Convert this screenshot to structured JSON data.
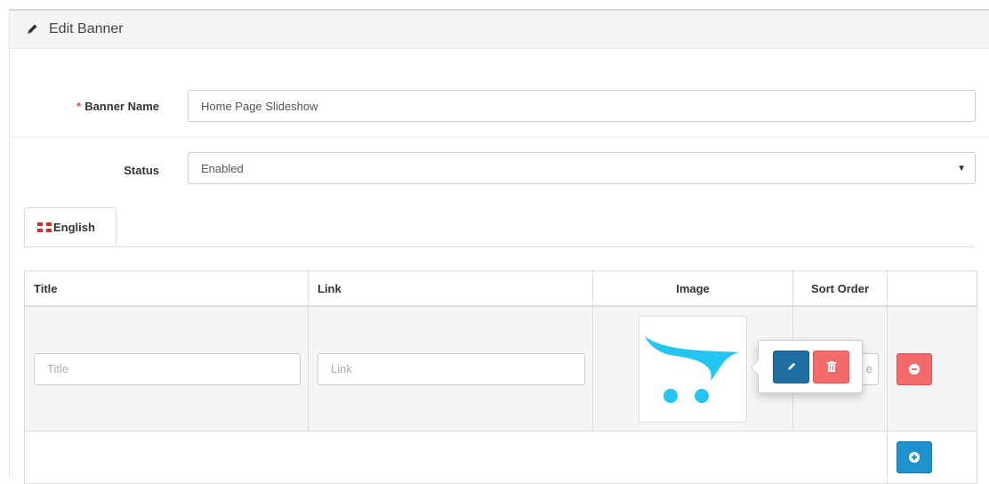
{
  "header": {
    "title": "Edit Banner",
    "icon": "pencil-icon"
  },
  "form": {
    "banner_name": {
      "required_mark": "*",
      "label": "Banner Name",
      "value": "Home Page Slideshow"
    },
    "status": {
      "label": "Status",
      "value": "Enabled"
    }
  },
  "tabs": [
    {
      "label": "English",
      "icon": "uk-flag-icon"
    }
  ],
  "table": {
    "columns": [
      "Title",
      "Link",
      "Image",
      "Sort Order",
      ""
    ],
    "rows": [
      {
        "title_placeholder": "Title",
        "link_placeholder": "Link",
        "image": "opencart-cart-logo",
        "sort_placeholder": "e"
      }
    ]
  },
  "colors": {
    "accent_blue": "#1e91cf",
    "edit_blue": "#1f6fa3",
    "danger_red": "#f56b6b",
    "required_red": "#f24545",
    "logo_cyan": "#23c6f0"
  }
}
